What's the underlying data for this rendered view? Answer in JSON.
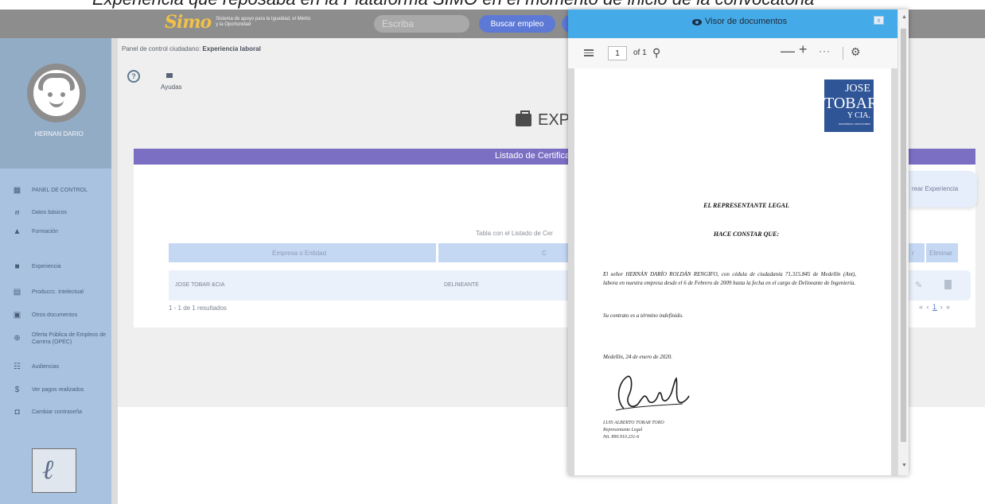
{
  "caption": "Experiencia que reposaba en la Plataforma SIMO en el momento de inicio de la convocatoria",
  "topbar": {
    "logo_mark": "Simo",
    "logo_tagline": "Sistema de apoyo para la Igualdad, el Mérito y la Oportunidad",
    "search_placeholder": "Escriba",
    "search_button": "Buscar empleo"
  },
  "sidebar": {
    "username": "HERNAN DARIO",
    "items": [
      {
        "label": "PANEL DE CONTROL",
        "icon": "dashboard-icon"
      },
      {
        "label": "Datos básicos",
        "icon": "user-data-icon"
      },
      {
        "label": "Formación",
        "icon": "graduation-icon"
      },
      {
        "label": "Experiencia",
        "icon": "briefcase-icon"
      },
      {
        "label": "Produccc. Intelectual",
        "icon": "book-icon"
      },
      {
        "label": "Otros documentos",
        "icon": "document-icon"
      },
      {
        "label": "Oferta Pública de Empleos de Carrera (OPEC)",
        "icon": "public-offer-icon"
      },
      {
        "label": "Audiencias",
        "icon": "audience-icon"
      },
      {
        "label": "Ver pagos realizados",
        "icon": "payment-icon"
      },
      {
        "label": "Cambiar contraseña",
        "icon": "lock-icon"
      }
    ]
  },
  "main": {
    "breadcrumb_prefix": "Panel de control ciudadano:",
    "breadcrumb_current": "Experiencia laboral",
    "help_label": "Ayudas",
    "page_title": "EXPE",
    "card_title": "Listado de Certifica",
    "table_caption": "Tabla con el Listado de Cer",
    "columns": [
      "Empresa o Entidad",
      "C"
    ],
    "rows": [
      {
        "empresa": "JOSE TOBAR &CIA",
        "cargo": "DELINEANTE"
      }
    ],
    "results": "1 - 1 de 1 resultados",
    "right": {
      "create_button": "rear Experiencia",
      "col_edit": "r",
      "col_delete": "Eliminar",
      "pager_prev": "« ‹",
      "pager_current": "1",
      "pager_next": "› »"
    }
  },
  "viewer": {
    "title": "Visor de documentos",
    "close": "x",
    "page_value": "1",
    "page_of": "of 1",
    "document": {
      "logo_line1": "JOSE",
      "logo_line2": "TOBAR",
      "logo_line3": "Y CIA.",
      "logo_line4": "INGENIEROS CONSULTORES",
      "heading1": "EL REPRESENTANTE LEGAL",
      "heading2": "HACE CONSTAR QUE:",
      "para1": "El señor HERNÁN DARÍO ROLDÁN RENGIFO, con cédula de ciudadanía 71.315.845 de Medellín (Ant), labora en nuestra empresa desde el 6 de Febrero de 2009 hasta la fecha en el cargo de Delineante de Ingeniería.",
      "para2": "Su contrato es a término indefinido.",
      "place_date": "Medellín, 24 de enero de 2020.",
      "signer_name": "LUIS ALBERTO TOBAR TORO",
      "signer_role": "Representante Legal",
      "signer_nit": "Nit. 890.910.231-6"
    }
  }
}
